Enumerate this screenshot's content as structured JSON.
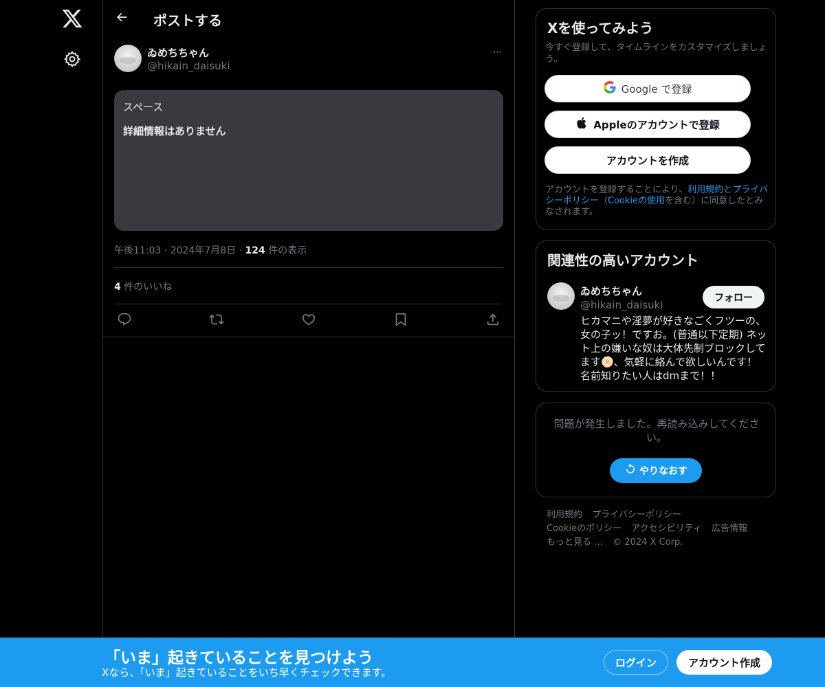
{
  "nav": {
    "logo_icon": "x-logo-icon",
    "settings_icon": "gear-icon"
  },
  "main": {
    "back_icon": "arrow-left-icon",
    "title": "ポストする",
    "author": {
      "name": "ゐめちちゃん",
      "handle": "@hikain_daisuki"
    },
    "more_label": "···",
    "space_card": {
      "label": "スペース",
      "detail": "詳細情報はありません"
    },
    "meta": {
      "time": "午後11:03",
      "sep1": " · ",
      "date": "2024年7月8日",
      "sep2": " · ",
      "views": "124",
      "views_suffix": " 件の表示"
    },
    "likes": {
      "count": "4",
      "suffix": " 件のいいね"
    },
    "actions": [
      "reply-icon",
      "retweet-icon",
      "like-icon",
      "bookmark-icon",
      "share-icon"
    ]
  },
  "signup": {
    "title": "Xを使ってみよう",
    "subtitle": "今すぐ登録して、タイムラインをカスタマイズしましょう。",
    "google_label": "Google で登録",
    "apple_label": "Appleのアカウントで登録",
    "create_label": "アカウントを作成",
    "legal_prefix": "アカウントを登録することにより、",
    "legal_terms": "利用規約",
    "legal_and": "と",
    "legal_privacy": "プライバシーポリシー",
    "legal_mid": "（",
    "legal_cookie": "Cookieの使用",
    "legal_suffix": "を含む）に同意したとみなされます。"
  },
  "related": {
    "title": "関連性の高いアカウント",
    "name": "ゐめちちゃん",
    "handle": "@hikain_daisuki",
    "follow_label": "フォロー",
    "bio": "ヒカマニや淫夢が好きなごくフツーの、女の子ッ！ですお。(普通以下定期) ネット上の嫌いな奴は大体先制ブロックしてます🫓、気軽に絡んで欲しいんです！ 名前知りたい人はdmまで！！"
  },
  "error": {
    "message": "問題が発生しました。再読み込みしてください。",
    "retry_label": "やりなおす"
  },
  "footer": {
    "links": [
      "利用規約",
      "プライバシーポリシー",
      "Cookieのポリシー",
      "アクセシビリティ",
      "広告情報",
      "もっと見る …"
    ],
    "copyright": "© 2024 X Corp."
  },
  "banner": {
    "title": "「いま」起きていることを見つけよう",
    "subtitle": "Xなら、「いま」起きていることをいち早くチェックできます。",
    "login_label": "ログイン",
    "signup_label": "アカウント作成"
  },
  "colors": {
    "background": "#000000",
    "accent": "#1d9bf0",
    "border": "#2f3336",
    "muted_text": "#71767b",
    "card": "#3a393f"
  }
}
